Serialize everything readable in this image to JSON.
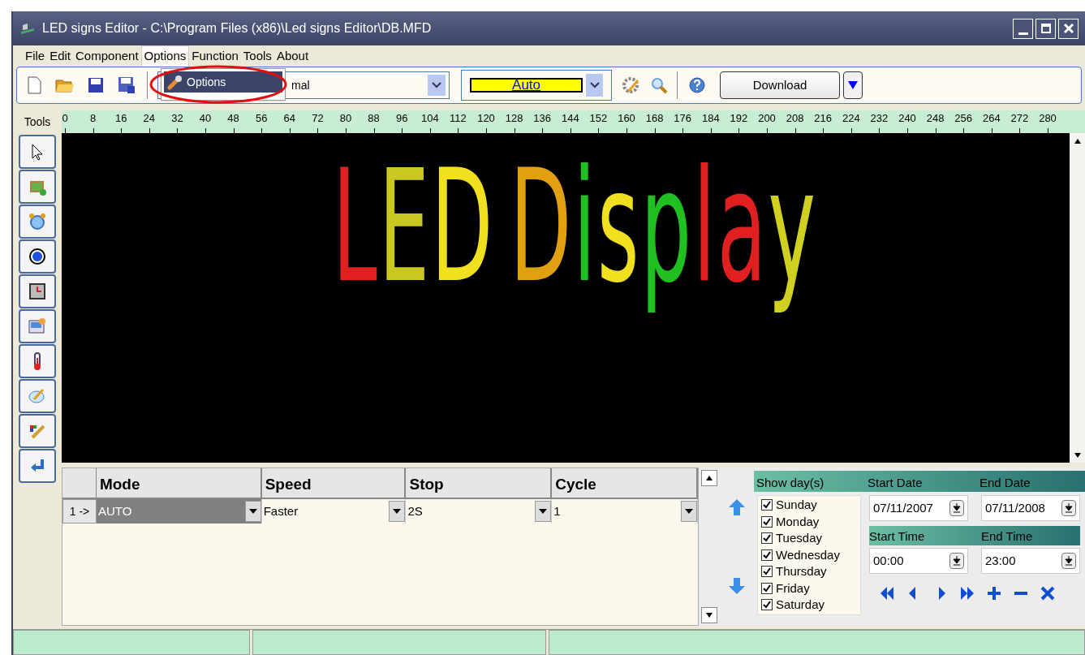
{
  "window": {
    "title": "LED signs Editor - C:\\Program Files (x86)\\Led signs Editor\\DB.MFD"
  },
  "menu": [
    {
      "label": "File",
      "selected": false
    },
    {
      "label": "Edit",
      "selected": false
    },
    {
      "label": "Component",
      "selected": false
    },
    {
      "label": "Options",
      "selected": true
    },
    {
      "label": "Function",
      "selected": false
    },
    {
      "label": "Tools",
      "selected": false
    },
    {
      "label": "About",
      "selected": false
    }
  ],
  "open_menu": {
    "items": [
      {
        "label": "Options",
        "selected": true
      }
    ]
  },
  "toolbar": {
    "font_combo_value": "mal",
    "color_combo_value": "Auto",
    "download_button": "Download"
  },
  "ruler": {
    "label": "Tools",
    "ticks": [
      "0",
      "8",
      "16",
      "24",
      "32",
      "40",
      "48",
      "56",
      "64",
      "72",
      "80",
      "88",
      "96",
      "104",
      "112",
      "120",
      "128",
      "136",
      "144",
      "152",
      "160",
      "168",
      "176",
      "184",
      "192",
      "200",
      "208",
      "216",
      "224",
      "232",
      "240",
      "248",
      "256",
      "264",
      "272",
      "280"
    ]
  },
  "display": {
    "words": [
      {
        "letters": [
          {
            "char": "L",
            "color": "#e02020"
          },
          {
            "char": "E",
            "color": "#c8c820"
          },
          {
            "char": "D",
            "color": "#f0e020"
          }
        ]
      },
      {
        "letters": [
          {
            "char": "D",
            "color": "#e0a010"
          },
          {
            "char": "i",
            "color": "#20c020"
          },
          {
            "char": "s",
            "color": "#f0e020"
          },
          {
            "char": "p",
            "color": "#20c020"
          },
          {
            "char": "l",
            "color": "#e02020"
          },
          {
            "char": "a",
            "color": "#e02020"
          },
          {
            "char": "y",
            "color": "#d0d020"
          }
        ]
      }
    ]
  },
  "grid": {
    "columns": [
      "Mode",
      "Speed",
      "Stop",
      "Cycle"
    ],
    "rows": [
      {
        "header": "1 ->",
        "cells": [
          {
            "value": "AUTO",
            "selected": true
          },
          {
            "value": "Faster",
            "selected": false
          },
          {
            "value": "2S",
            "selected": false
          },
          {
            "value": "1",
            "selected": false
          }
        ]
      }
    ]
  },
  "schedule": {
    "days_label": "Show day(s)",
    "start_date_label": "Start Date",
    "end_date_label": "End Date",
    "days": [
      {
        "label": "Sunday",
        "checked": true
      },
      {
        "label": "Monday",
        "checked": true
      },
      {
        "label": "Tuesday",
        "checked": true
      },
      {
        "label": "Wednesday",
        "checked": true
      },
      {
        "label": "Thursday",
        "checked": true
      },
      {
        "label": "Friday",
        "checked": true
      },
      {
        "label": "Saturday",
        "checked": true
      }
    ],
    "start_date": "07/11/2007",
    "end_date": "07/11/2008",
    "start_time_label": "Start Time",
    "end_time_label": "End Time",
    "start_time": "00:00",
    "end_time": "23:00"
  }
}
